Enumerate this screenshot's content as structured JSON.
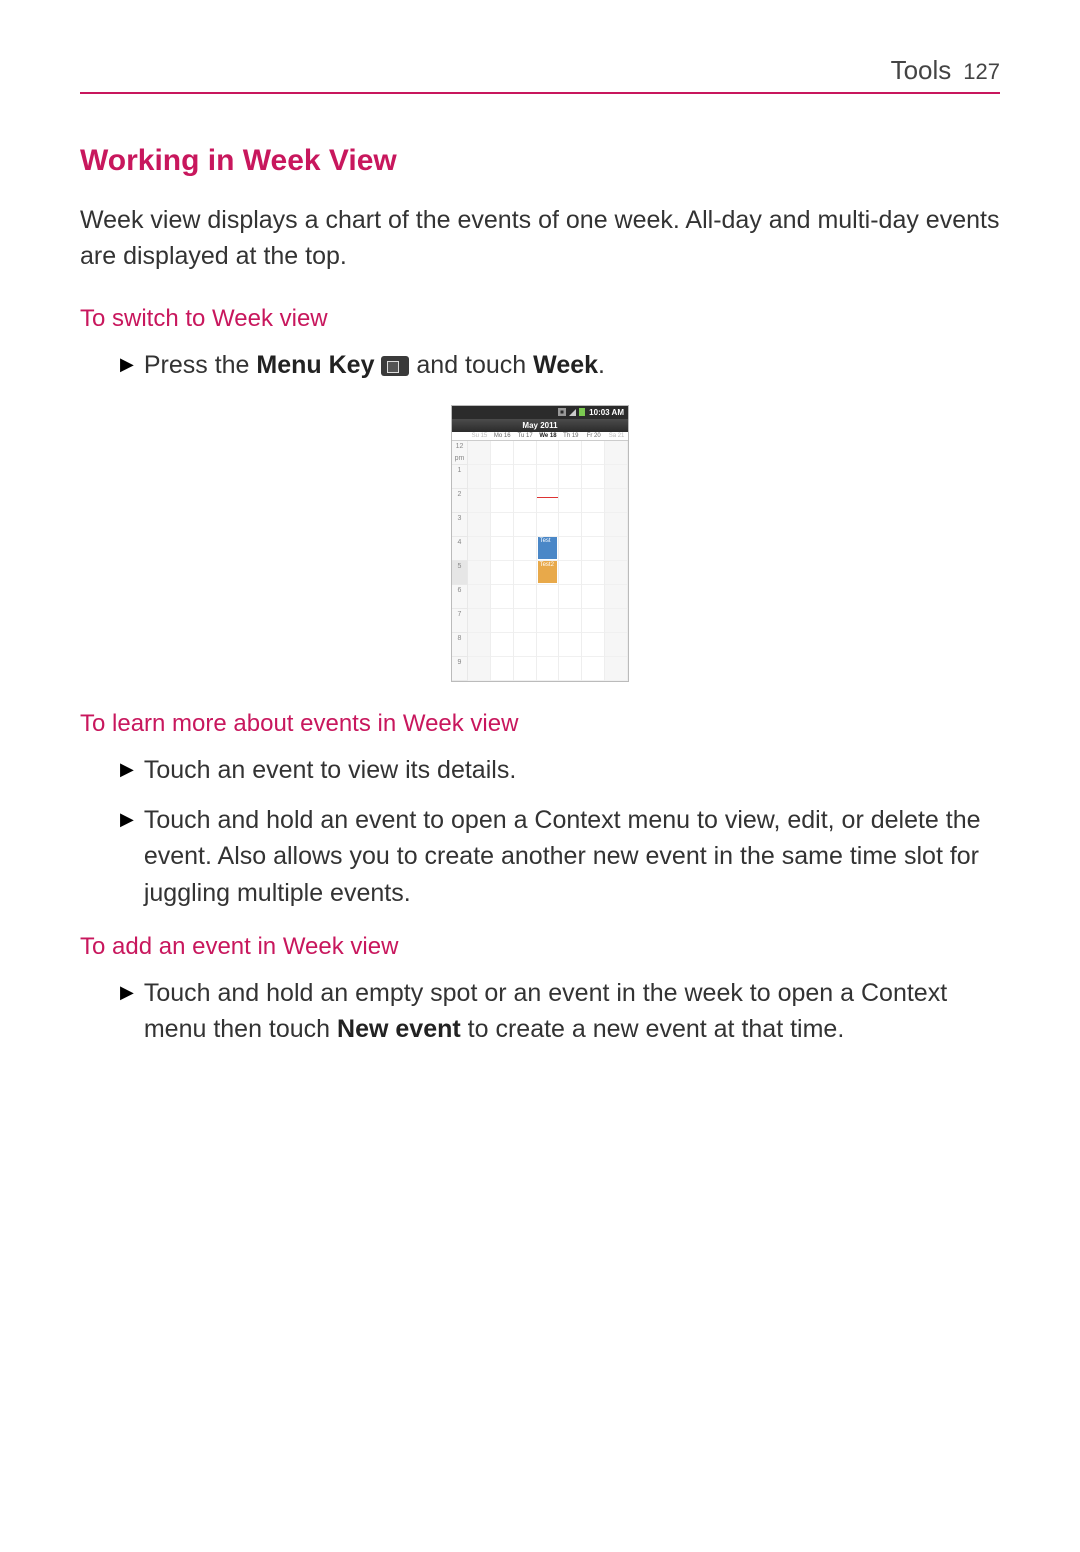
{
  "header": {
    "section": "Tools",
    "page_number": "127"
  },
  "section_title": "Working in Week View",
  "intro": "Week view displays a chart of the events of one week. All-day and multi-day events are displayed at the top.",
  "sub1_title": "To switch to Week view",
  "sub1_bullet_pre": "Press the ",
  "sub1_bullet_bold1": "Menu Key",
  "sub1_bullet_mid": " and touch ",
  "sub1_bullet_bold2": "Week",
  "sub1_bullet_end": ".",
  "phone": {
    "time": "10:03 AM",
    "month": "May 2011",
    "days": [
      "Su 15",
      "Mo 16",
      "Tu 17",
      "We 18",
      "Th 19",
      "Fr 20",
      "Sa 21"
    ],
    "hours": [
      "12\npm",
      "1",
      "2",
      "3",
      "4",
      "5",
      "6",
      "7",
      "8",
      "9"
    ],
    "event1": "Test",
    "event2": "Test2"
  },
  "sub2_title": "To learn more about events in Week view",
  "sub2_b1": "Touch an event to view its details.",
  "sub2_b2": "Touch and hold an event to open a Context menu to view, edit, or delete the event. Also allows you to create another new event in the same time slot for juggling multiple events.",
  "sub3_title": "To add an event in Week view",
  "sub3_b1_pre": "Touch and hold an empty spot or an event in the week to open a Context menu then touch ",
  "sub3_b1_bold": "New event",
  "sub3_b1_post": " to create a new event at that time."
}
